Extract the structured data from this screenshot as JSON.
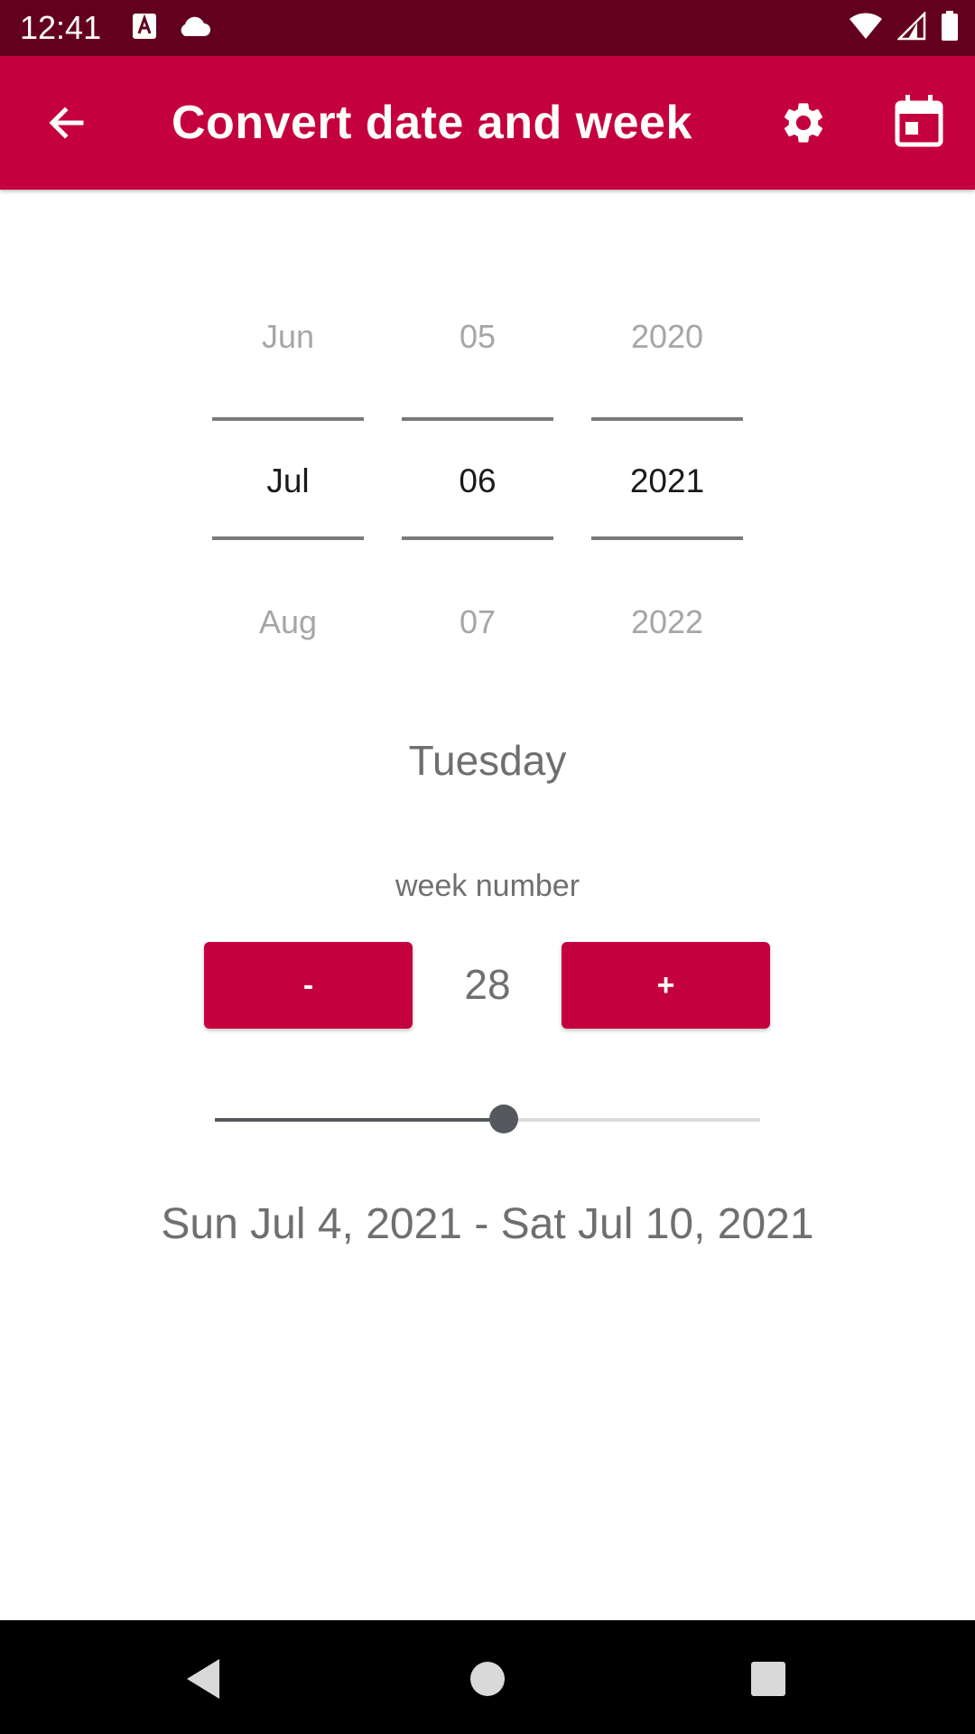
{
  "status_bar": {
    "time": "12:41",
    "icons": [
      "a-notification-icon",
      "cloud-icon",
      "wifi-icon",
      "signal-icon",
      "battery-icon"
    ]
  },
  "app_bar": {
    "title": "Convert date and week",
    "background": "#C5003E",
    "icons": [
      "back-arrow-icon",
      "gear-icon",
      "calendar-icon"
    ]
  },
  "date_picker": {
    "month": {
      "prev": "Jun",
      "current": "Jul",
      "next": "Aug"
    },
    "day": {
      "prev": "05",
      "current": "06",
      "next": "07"
    },
    "year": {
      "prev": "2020",
      "current": "2021",
      "next": "2022"
    }
  },
  "weekday": "Tuesday",
  "week": {
    "label": "week number",
    "value": "28",
    "minus_label": "-",
    "plus_label": "+",
    "slider_fraction": 0.53
  },
  "date_range": "Sun Jul 4, 2021 - Sat Jul 10, 2021",
  "colors": {
    "accent": "#C5003E",
    "status_bar": "#64001F",
    "slider": "#55595e"
  },
  "nav_bar": {
    "icons": [
      "back-triangle-icon",
      "home-circle-icon",
      "recents-square-icon"
    ]
  }
}
